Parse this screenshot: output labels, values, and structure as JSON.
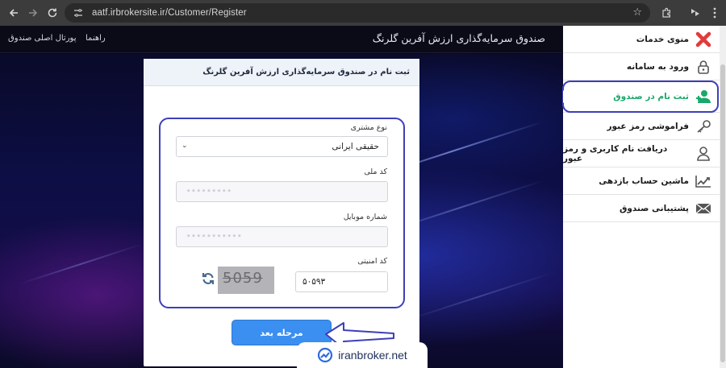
{
  "browser": {
    "url": "aatf.irbrokersite.ir/Customer/Register",
    "back_icon": "arrow-left-icon",
    "forward_icon": "arrow-right-icon",
    "reload_icon": "reload-icon"
  },
  "topbar": {
    "site_title": "صندوق سرمایه‌گذاری ارزش آفرین گلرنگ",
    "links": [
      "راهنما",
      "پورتال اصلی صندوق"
    ]
  },
  "card": {
    "title": "ثبت نام در صندوق سرمایه‌گذاری ارزش آفرین گلرنگ",
    "customer_type_label": "نوع مشتری",
    "customer_type_value": "حقیقی ایرانی",
    "national_code_label": "کد ملی",
    "national_code_value": "•••••••••",
    "mobile_label": "شماره موبایل",
    "mobile_value": "•••••••••••",
    "captcha_label": "کد امنیتی",
    "captcha_input_value": "۵۰۵۹۳",
    "captcha_image_text": "5059",
    "next_button": "مرحله بعد"
  },
  "sidebar": {
    "items": [
      {
        "label": "منوی خدمات",
        "icon": "close-x-icon"
      },
      {
        "label": "ورود به سامانه",
        "icon": "lock-icon"
      },
      {
        "label": "ثبت نام در صندوق",
        "icon": "add-user-icon"
      },
      {
        "label": "فراموشی رمز عبور",
        "icon": "key-icon"
      },
      {
        "label": "دریافت نام کاربری و رمز عبور",
        "icon": "user-icon"
      },
      {
        "label": "ماشین حساب بازدهی",
        "icon": "chart-icon"
      },
      {
        "label": "پشتیبانی صندوق",
        "icon": "envelope-icon"
      }
    ],
    "active_index": 2
  },
  "watermark": {
    "text": "iranbroker.net"
  },
  "colors": {
    "accent_blue": "#3a8ff0",
    "highlight_ring": "#3d3fb8",
    "active_green": "#1aa86a",
    "close_red": "#e23a3a"
  }
}
